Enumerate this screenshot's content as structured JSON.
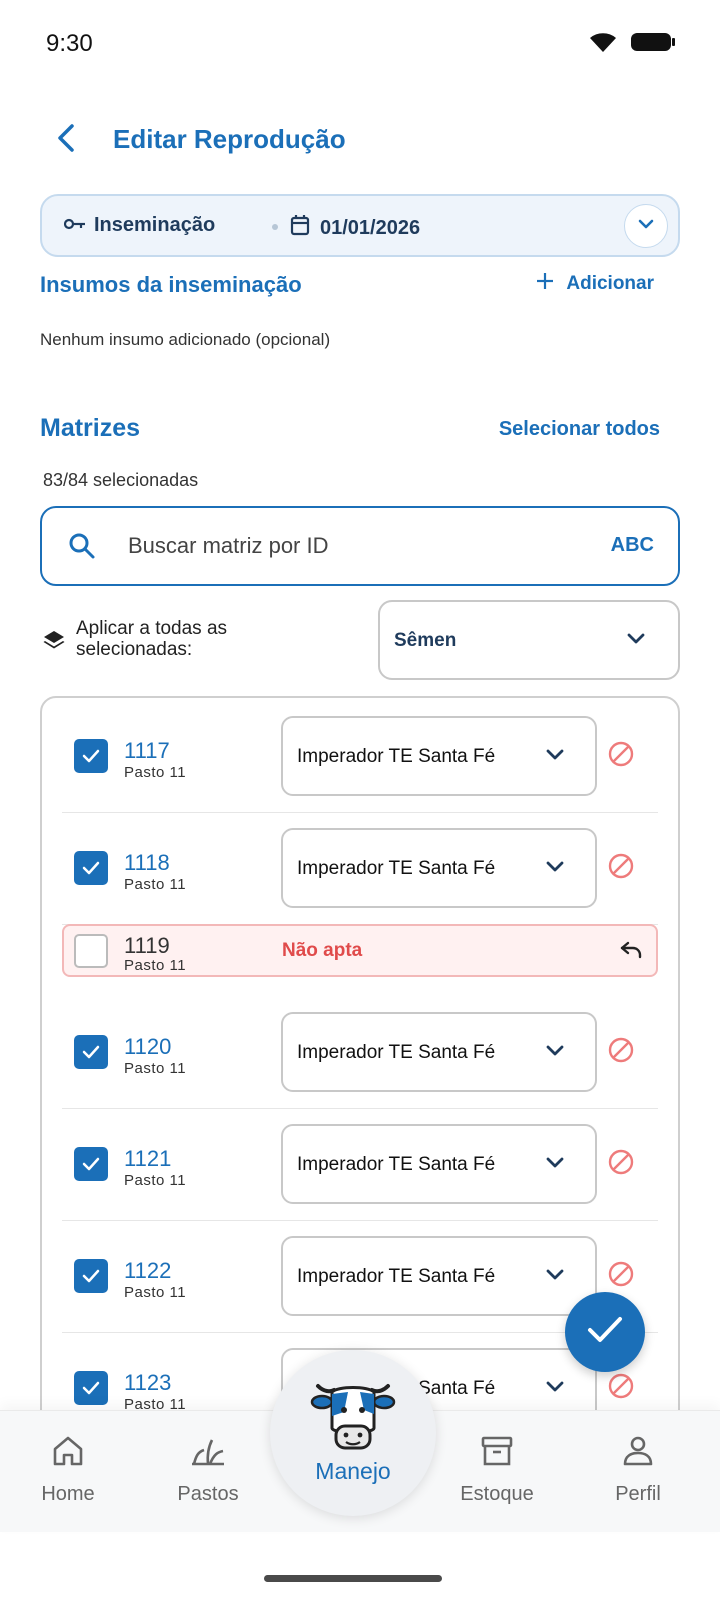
{
  "status_bar": {
    "time": "9:30"
  },
  "header": {
    "title": "Editar Reprodução"
  },
  "summary": {
    "type": "Inseminação",
    "date": "01/01/2026"
  },
  "insumos": {
    "title": "Insumos da inseminação",
    "add_label": "Adicionar",
    "empty_text": "Nenhum insumo adicionado (opcional)"
  },
  "matrizes": {
    "title": "Matrizes",
    "select_all_label": "Selecionar todos",
    "selected_count": "83/84 selecionadas",
    "search_placeholder": "Buscar matriz por ID",
    "keyboard_toggle": "ABC",
    "apply_label": "Aplicar a todas as selecionadas:",
    "apply_value": "Sêmen",
    "rows": [
      {
        "id": "1117",
        "pasto": "Pasto 11",
        "semen": "Imperador TE Santa Fé",
        "checked": true
      },
      {
        "id": "1118",
        "pasto": "Pasto 11",
        "semen": "Imperador TE Santa Fé",
        "checked": true
      },
      {
        "id": "1119",
        "pasto": "Pasto 11",
        "status": "Não apta",
        "checked": false
      },
      {
        "id": "1120",
        "pasto": "Pasto 11",
        "semen": "Imperador TE Santa Fé",
        "checked": true
      },
      {
        "id": "1121",
        "pasto": "Pasto 11",
        "semen": "Imperador TE Santa Fé",
        "checked": true
      },
      {
        "id": "1122",
        "pasto": "Pasto 11",
        "semen": "Imperador TE Santa Fé",
        "checked": true
      },
      {
        "id": "1123",
        "pasto": "Pasto 11",
        "semen": "Imperador TE Santa Fé",
        "checked": true
      }
    ]
  },
  "bottom_nav": {
    "home": "Home",
    "pastos": "Pastos",
    "manejo": "Manejo",
    "estoque": "Estoque",
    "perfil": "Perfil"
  },
  "colors": {
    "primary": "#1b6fb8",
    "danger": "#e04b4b",
    "summary_bg": "#eef4fb"
  }
}
